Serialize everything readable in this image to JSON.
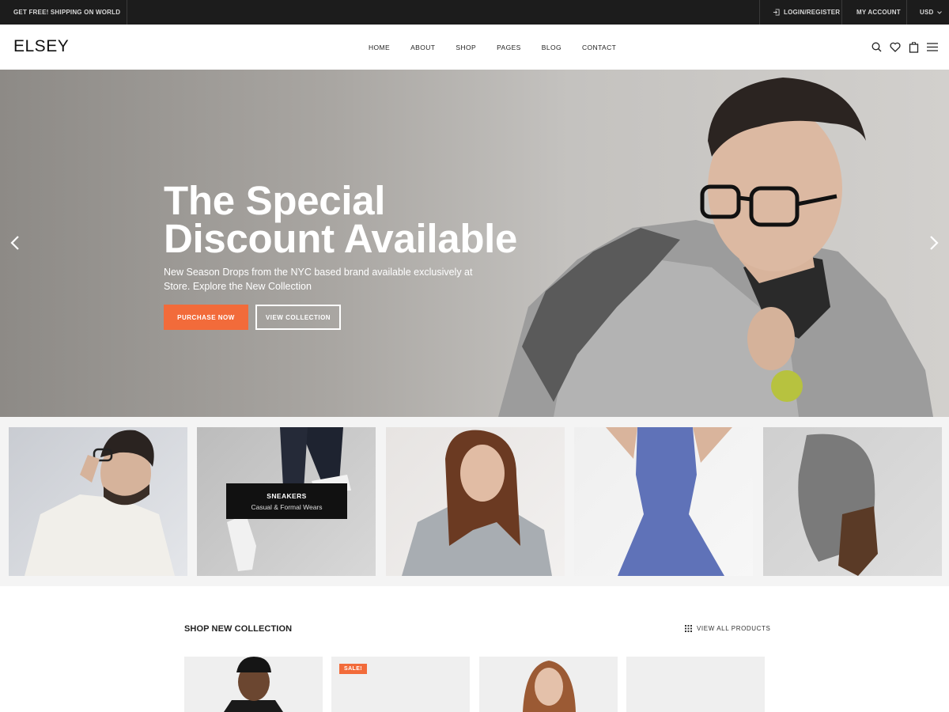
{
  "topbar": {
    "shipping": "GET FREE! SHIPPING ON WORLD WIDE",
    "login": "LOGIN/REGISTER",
    "account": "MY ACCOUNT",
    "currency": "USD"
  },
  "header": {
    "logo": "ELSEY",
    "nav": [
      "HOME",
      "ABOUT",
      "SHOP",
      "PAGES",
      "BLOG",
      "CONTACT"
    ]
  },
  "hero": {
    "title": "The Special\nDiscount Available",
    "subtitle": "New Season Drops from the NYC based brand available exclusively at Store. Explore the New Collection",
    "primary_button": "PURCHASE NOW",
    "secondary_button": "VIEW COLLECTION"
  },
  "categories": {
    "featured_title": "SNEAKERS",
    "featured_subtitle": "Casual & Formal Wears"
  },
  "collection": {
    "title": "SHOP NEW COLLECTION",
    "view_all": "VIEW ALL PRODUCTS",
    "sale_badge": "SALE!"
  },
  "colors": {
    "accent": "#f26b3a",
    "topbar": "#1c1c1c"
  },
  "icons": [
    "login-icon",
    "chevron-down-icon",
    "search-icon",
    "heart-icon",
    "cart-icon",
    "menu-icon",
    "arrow-left-icon",
    "arrow-right-icon",
    "grid-icon"
  ]
}
